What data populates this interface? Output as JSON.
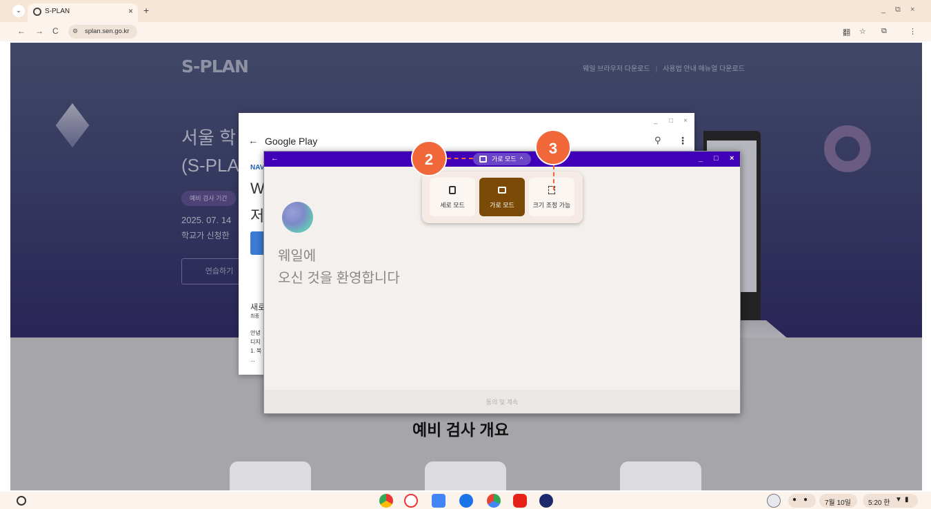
{
  "browser": {
    "tab_title": "S-PLAN",
    "tab_close": "×",
    "new_tab": "+",
    "url": "splan.sen.go.kr",
    "window_controls": [
      "_",
      "⧉",
      "×"
    ]
  },
  "page": {
    "logo": "S-PLAN",
    "links": [
      "웨일 브라우저 다운로드",
      "사용법 안내 매뉴얼 다운로드"
    ],
    "hero_title_lines": [
      "서울 학",
      "(S-PLA"
    ],
    "badge": "예비 검사 기간",
    "date": "2025. 07. 14",
    "desc": "학교가 신청한",
    "button": "연습하기",
    "section_title": "예비 검사 개요"
  },
  "google_play": {
    "title": "Google Play",
    "partial_text": [
      "NAV",
      "W",
      "저",
      "새로",
      "최종",
      "안녕",
      "디지",
      "1. 북",
      "..."
    ]
  },
  "whale_window": {
    "mode_pill_label": "가로 모드",
    "welcome_line1": "웨일에",
    "welcome_line2": "오신 것을 환영합니다",
    "footer": "동의 및 계속"
  },
  "mode_popup": {
    "options": [
      {
        "label": "세로 모드",
        "active": false
      },
      {
        "label": "가로 모드",
        "active": true
      },
      {
        "label": "크기 조정 가능",
        "active": false
      }
    ]
  },
  "callouts": [
    "2",
    "3"
  ],
  "shelf": {
    "date": "7월 10일",
    "time": "5:20 한"
  },
  "colors": {
    "accent_orange": "#f2673a",
    "titlebar_purple": "#4000b8",
    "active_mode": "#7a4a06"
  }
}
